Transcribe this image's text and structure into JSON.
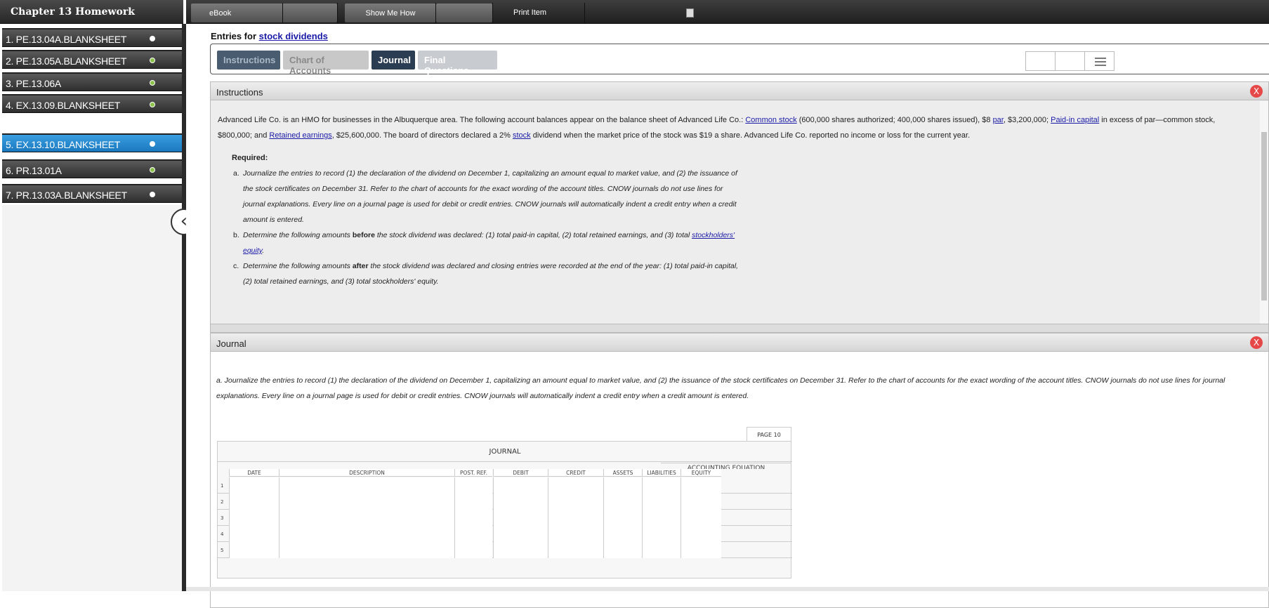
{
  "sidebar": {
    "title": "Chapter 13 Homework",
    "items": [
      {
        "label": "1. PE.13.04A.BLANKSHEET",
        "status": "not-started"
      },
      {
        "label": "2. PE.13.05A.BLANKSHEET",
        "status": "complete"
      },
      {
        "label": "3. PE.13.06A",
        "status": "complete"
      },
      {
        "label": "4. EX.13.09.BLANKSHEET",
        "status": "complete"
      },
      {
        "label": "5. EX.13.10.BLANKSHEET",
        "status": "active"
      },
      {
        "label": "6. PR.13.01A",
        "status": "complete"
      },
      {
        "label": "7. PR.13.03A.BLANKSHEET",
        "status": "not-started"
      }
    ],
    "collapse_icon": "chevron-left-icon"
  },
  "toolbar": {
    "ebook": "eBook",
    "show_me_how": "Show Me How",
    "print_item": "Print Item"
  },
  "header": {
    "entries_for": "Entries for",
    "topic_link": "stock dividends"
  },
  "tabs": [
    {
      "label": "Instructions"
    },
    {
      "label": "Chart of Accounts"
    },
    {
      "label": "Journal"
    },
    {
      "label": "Final Questions"
    }
  ],
  "instructions": {
    "panel_title": "Instructions",
    "close": "X",
    "p1": "Advanced Life Co. is an HMO for businesses in the Albuquerque area. The following account balances appear on the balance sheet of Advanced Life Co.: ",
    "link_common_stock": "Common stock",
    "p2": " (600,000 shares authorized; 400,000 shares issued), $8 ",
    "link_par": "par",
    "p3": ", $3,200,000; ",
    "link_paid_in": "Paid-in capital",
    "p4": " in excess of par—common stock, $800,000; and ",
    "link_retained": "Retained earnings",
    "p5": ", $25,600,000. The board of directors declared a 2% ",
    "link_stock": "stock",
    "p6": " dividend when the market price of the stock was $19 a share. Advanced Life Co. reported no income or loss for the current year.",
    "required": "Required:",
    "a_letter": "a.",
    "a_text": "Journalize the entries to record (1) the declaration of the dividend on December 1, capitalizing an amount equal to market value, and (2) the issuance of the stock certificates on December 31. Refer to the chart of accounts for the exact wording of the account titles. CNOW journals do not use lines for journal explanations. Every line on a journal page is used for debit or credit entries. CNOW journals will automatically indent a credit entry when a credit amount is entered.",
    "b_letter": "b.",
    "b_pre": "Determine the following amounts ",
    "b_bold": "before",
    "b_post": " the stock dividend was declared: (1) total paid-in capital, (2) total retained earnings, and (3) total ",
    "b_link": "stockholders' equity",
    "b_end": ".",
    "c_letter": "c.",
    "c_pre": "Determine the following amounts ",
    "c_bold": "after",
    "c_post": " the stock dividend was declared and closing entries were recorded at the end of the year: (1) total paid-in capital, (2) total retained earnings, and (3) total stockholders' equity."
  },
  "journal": {
    "panel_title": "Journal",
    "close": "X",
    "instruction": "a. Journalize the entries to record (1) the declaration of the dividend on December 1, capitalizing an amount equal to market value, and (2) the issuance of the stock certificates on December 31. Refer to the chart of accounts for the exact wording of the account titles. CNOW journals do not use lines for journal explanations. Every line on a journal page is used for debit or credit entries. CNOW journals will automatically indent a credit entry when a credit amount is entered.",
    "page_label": "PAGE 10",
    "table_title": "JOURNAL",
    "accounting_equation": "ACCOUNTING EQUATION",
    "columns": [
      "DATE",
      "DESCRIPTION",
      "POST. REF.",
      "DEBIT",
      "CREDIT",
      "ASSETS",
      "LIABILITIES",
      "EQUITY"
    ],
    "rows": [
      "1",
      "2",
      "3",
      "4",
      "5"
    ]
  },
  "colors": {
    "active_item": "#1a78bf",
    "complete_dot": "#8bc34a",
    "close_button": "#e64848",
    "journal_tab": "#2b3d52",
    "link": "#1a1aa8"
  }
}
